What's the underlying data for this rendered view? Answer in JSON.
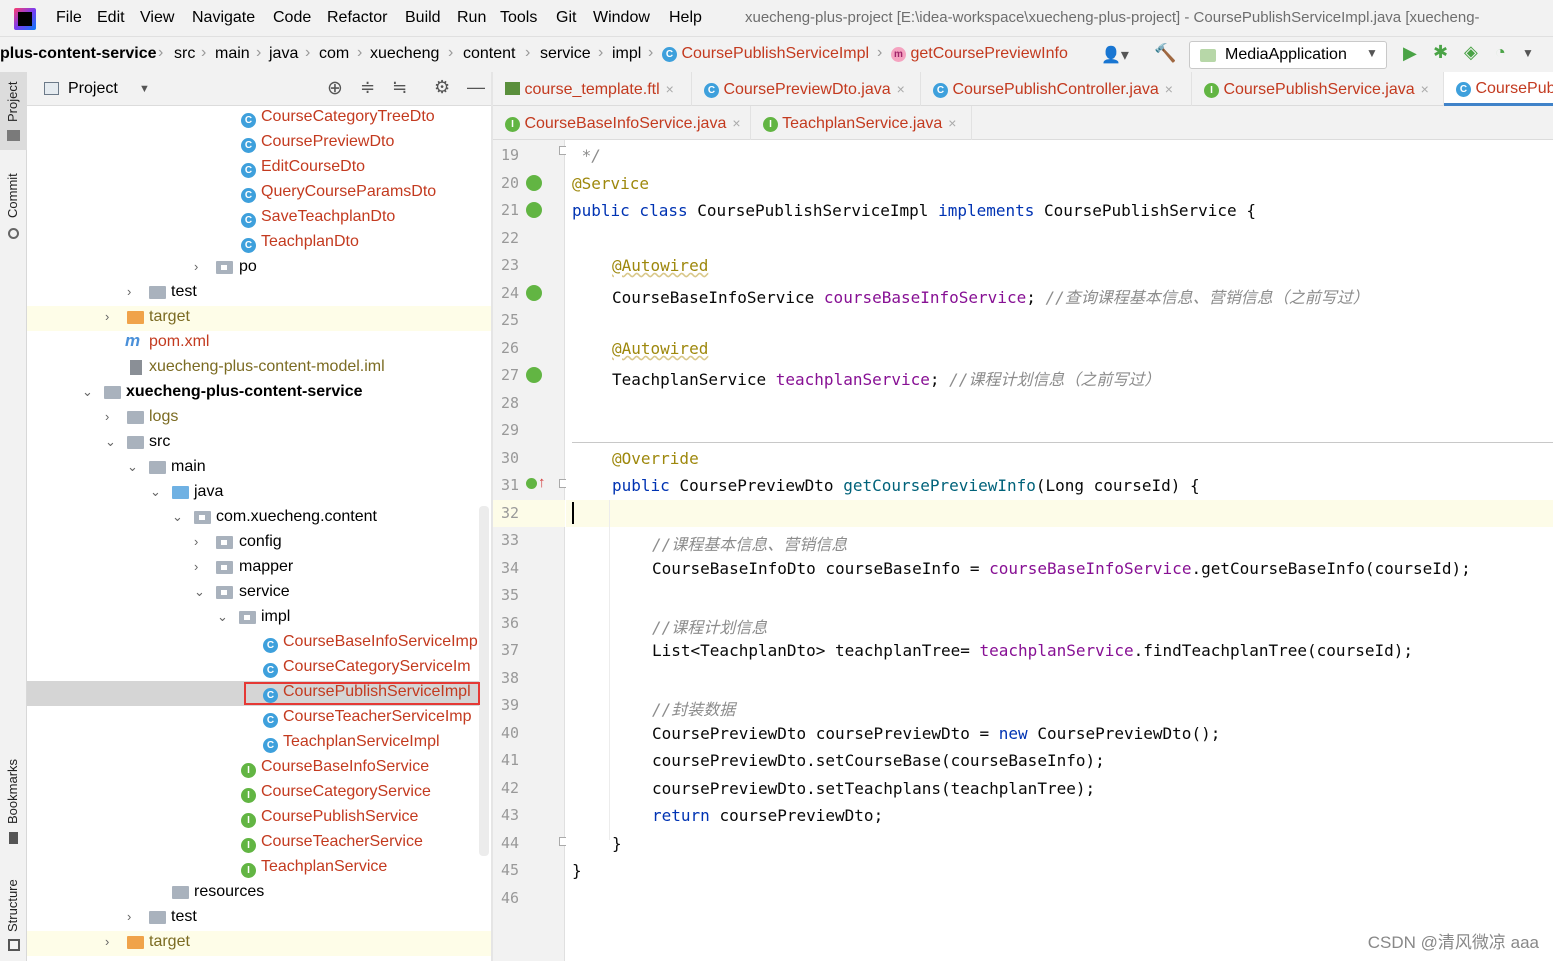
{
  "window": {
    "title": "xuecheng-plus-project [E:\\idea-workspace\\xuecheng-plus-project] - CoursePublishServiceImpl.java [xuecheng-"
  },
  "menu": [
    "File",
    "Edit",
    "View",
    "Navigate",
    "Code",
    "Refactor",
    "Build",
    "Run",
    "Tools",
    "Git",
    "Window",
    "Help"
  ],
  "breadcrumb": [
    "plus-content-service",
    "src",
    "main",
    "java",
    "com",
    "xuecheng",
    "content",
    "service",
    "impl",
    "CoursePublishServiceImpl",
    "getCoursePreviewInfo"
  ],
  "run_config": "MediaApplication",
  "project_panel": {
    "title": "Project"
  },
  "side_tools": {
    "project": "Project",
    "commit": "Commit",
    "bookmarks": "Bookmarks",
    "structure": "Structure"
  },
  "tree": [
    {
      "label": "CourseCategoryTreeDto",
      "icon": "class"
    },
    {
      "label": "CoursePreviewDto",
      "icon": "class"
    },
    {
      "label": "EditCourseDto",
      "icon": "class"
    },
    {
      "label": "QueryCourseParamsDto",
      "icon": "class"
    },
    {
      "label": "SaveTeachplanDto",
      "icon": "class"
    },
    {
      "label": "TeachplanDto",
      "icon": "class"
    },
    {
      "label": "po",
      "icon": "package"
    },
    {
      "label": "test",
      "icon": "folder"
    },
    {
      "label": "target",
      "icon": "folder-orange"
    },
    {
      "label": "pom.xml",
      "icon": "maven"
    },
    {
      "label": "xuecheng-plus-content-model.iml",
      "icon": "file"
    },
    {
      "label": "xuecheng-plus-content-service",
      "icon": "module"
    },
    {
      "label": "logs",
      "icon": "folder"
    },
    {
      "label": "src",
      "icon": "folder"
    },
    {
      "label": "main",
      "icon": "folder"
    },
    {
      "label": "java",
      "icon": "folder-blue"
    },
    {
      "label": "com.xuecheng.content",
      "icon": "package"
    },
    {
      "label": "config",
      "icon": "package"
    },
    {
      "label": "mapper",
      "icon": "package"
    },
    {
      "label": "service",
      "icon": "package"
    },
    {
      "label": "impl",
      "icon": "package"
    },
    {
      "label": "CourseBaseInfoServiceImp",
      "icon": "class"
    },
    {
      "label": "CourseCategoryServiceIm",
      "icon": "class"
    },
    {
      "label": "CoursePublishServiceImpl",
      "icon": "class"
    },
    {
      "label": "CourseTeacherServiceImp",
      "icon": "class"
    },
    {
      "label": "TeachplanServiceImpl",
      "icon": "class"
    },
    {
      "label": "CourseBaseInfoService",
      "icon": "interface"
    },
    {
      "label": "CourseCategoryService",
      "icon": "interface"
    },
    {
      "label": "CoursePublishService",
      "icon": "interface"
    },
    {
      "label": "CourseTeacherService",
      "icon": "interface"
    },
    {
      "label": "TeachplanService",
      "icon": "interface"
    },
    {
      "label": "resources",
      "icon": "folder"
    },
    {
      "label": "test",
      "icon": "folder"
    },
    {
      "label": "target",
      "icon": "folder-orange"
    }
  ],
  "tabs_row1": [
    {
      "label": "course_template.ftl",
      "icon": "ftl"
    },
    {
      "label": "CoursePreviewDto.java",
      "icon": "class"
    },
    {
      "label": "CoursePublishController.java",
      "icon": "class"
    },
    {
      "label": "CoursePublishService.java",
      "icon": "interface"
    },
    {
      "label": "CoursePub",
      "icon": "class"
    }
  ],
  "tabs_row2": [
    {
      "label": "CourseBaseInfoService.java",
      "icon": "interface"
    },
    {
      "label": "TeachplanService.java",
      "icon": "interface"
    }
  ],
  "line_numbers": [
    "19",
    "20",
    "21",
    "22",
    "23",
    "24",
    "25",
    "26",
    "27",
    "28",
    "29",
    "30",
    "31",
    "32",
    "33",
    "34",
    "35",
    "36",
    "37",
    "38",
    "39",
    "40",
    "41",
    "42",
    "43",
    "44",
    "45",
    "46"
  ],
  "code": {
    "l19": " */",
    "l20": "@Service",
    "l21_kw": "public class ",
    "l21_name": "CoursePublishServiceImpl ",
    "l21_impl": "implements ",
    "l21_rest": "CoursePublishService {",
    "l23": "@Autowired",
    "l24_type": "CourseBaseInfoService ",
    "l24_field": "courseBaseInfoService",
    "l24_semi": "; ",
    "l24_cmt": "//查询课程基本信息、营销信息（之前写过）",
    "l26": "@Autowired",
    "l27_type": "TeachplanService ",
    "l27_field": "teachplanService",
    "l27_semi": "; ",
    "l27_cmt": "//课程计划信息（之前写过）",
    "l30": "@Override",
    "l31_kw": "public ",
    "l31_type": "CoursePreviewDto ",
    "l31_method": "getCoursePreviewInfo",
    "l31_params": "(Long courseId) {",
    "l33": "//课程基本信息、营销信息",
    "l34_pre": "CourseBaseInfoDto courseBaseInfo = ",
    "l34_field": "courseBaseInfoService",
    "l34_post": ".getCourseBaseInfo(courseId);",
    "l36": "//课程计划信息",
    "l37_pre": "List<TeachplanDto> teachplanTree= ",
    "l37_field": "teachplanService",
    "l37_post": ".findTeachplanTree(courseId);",
    "l39": "//封装数据",
    "l40_pre": "CoursePreviewDto coursePreviewDto = ",
    "l40_kw": "new ",
    "l40_post": "CoursePreviewDto();",
    "l41": "coursePreviewDto.setCourseBase(courseBaseInfo);",
    "l42": "coursePreviewDto.setTeachplans(teachplanTree);",
    "l43_kw": "return ",
    "l43_post": "coursePreviewDto;",
    "l44": "}",
    "l45": "}"
  },
  "watermark": "CSDN @清风微凉 aaa",
  "colors": {
    "accent": "#4083c9",
    "file_modified": "#c33a1f",
    "selection_box": "#e53935"
  }
}
